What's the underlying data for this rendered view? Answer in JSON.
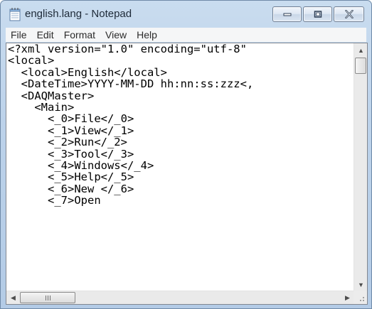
{
  "window": {
    "title": "english.lang - Notepad",
    "icons": {
      "app": "notepad-icon",
      "minimize": "minimize-icon",
      "maximize": "maximize-icon",
      "close": "close-icon"
    }
  },
  "menubar": {
    "items": [
      "File",
      "Edit",
      "Format",
      "View",
      "Help"
    ]
  },
  "editor": {
    "lines": [
      "<?xml version=\"1.0\" encoding=\"utf-8\"",
      "<local>",
      "  <local>English</local>",
      "  <DateTime>YYYY-MM-DD hh:nn:ss:zzz<,",
      "  <DAQMaster>",
      "    <Main>",
      "      <_0>File</_0>",
      "      <_1>View</_1>",
      "      <_2>Run</_2>",
      "      <_3>Tool</_3>",
      "      <_4>Windows</_4>",
      "      <_5>Help</_5>",
      "      <_6>New </_6>",
      "      <_7>Open"
    ]
  },
  "scrollbars": {
    "vertical": {
      "up_icon": "scroll-up-arrow-icon",
      "down_icon": "scroll-down-arrow-icon"
    },
    "horizontal": {
      "left_icon": "scroll-left-arrow-icon",
      "right_icon": "scroll-right-arrow-icon"
    }
  }
}
